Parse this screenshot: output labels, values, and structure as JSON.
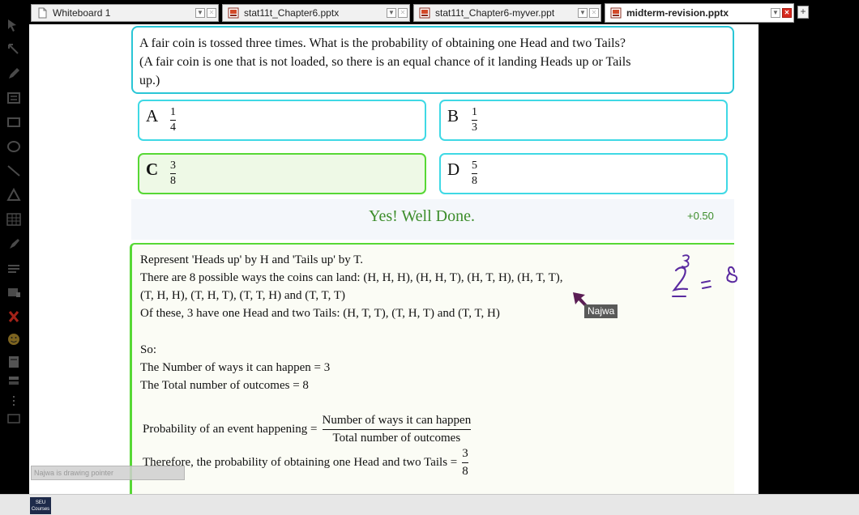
{
  "tabs": [
    {
      "label": "Whiteboard 1",
      "active": false
    },
    {
      "label": "stat11t_Chapter6.pptx",
      "active": false
    },
    {
      "label": "stat11t_Chapter6-myver.ppt",
      "active": false
    },
    {
      "label": "midterm-revision.pptx",
      "active": true
    }
  ],
  "add_tab_label": "+",
  "question": {
    "line1": "A fair coin is tossed three times. What is the probability of obtaining one Head and two Tails?",
    "line2": "(A fair coin is one that is not loaded, so there is an equal chance of it landing Heads up or Tails",
    "line3": "up.)"
  },
  "options": [
    {
      "letter": "A",
      "num": "1",
      "den": "4",
      "selected": false
    },
    {
      "letter": "B",
      "num": "1",
      "den": "3",
      "selected": false
    },
    {
      "letter": "C",
      "num": "3",
      "den": "8",
      "selected": true
    },
    {
      "letter": "D",
      "num": "5",
      "den": "8",
      "selected": false
    }
  ],
  "feedback": {
    "message": "Yes! Well Done.",
    "score": "+0.50"
  },
  "explanation": {
    "lines": [
      "Represent 'Heads up' by H and 'Tails up' by T.",
      "There are 8 possible ways the coins can land: (H, H, H), (H, H, T), (H, T, H), (H, T, T),",
      "(T, H, H), (T, H, T), (T, T, H) and (T, T, T)",
      "Of these, 3 have one Head and two Tails: (H, T, T), (T, H, T) and (T, T, H)",
      "So:",
      "The Number of ways it can happen = 3",
      "The Total number of outcomes = 8"
    ],
    "formula_lhs": "Probability of an event happening =",
    "formula_num": "Number of ways it can happen",
    "formula_den": "Total number of outcomes",
    "conclusion_text": "Therefore, the probability of obtaining one Head and two Tails =",
    "conclusion_num": "3",
    "conclusion_den": "8"
  },
  "annotation": {
    "handwriting": "2^3 = 8"
  },
  "pointer_user": "Najwa",
  "drawing_note": "Najwa is drawing pointer",
  "logo_text": "SEU Courses",
  "icons": {
    "tab_doc": "document-icon",
    "tab_ppt": "presentation-icon",
    "dropdown": "chevron-down-icon",
    "close": "close-icon"
  },
  "colors": {
    "option_border": "#3fd9e5",
    "correct_border": "#57d835",
    "feedback_green": "#3c8d2b",
    "close_red": "#d7291e"
  }
}
